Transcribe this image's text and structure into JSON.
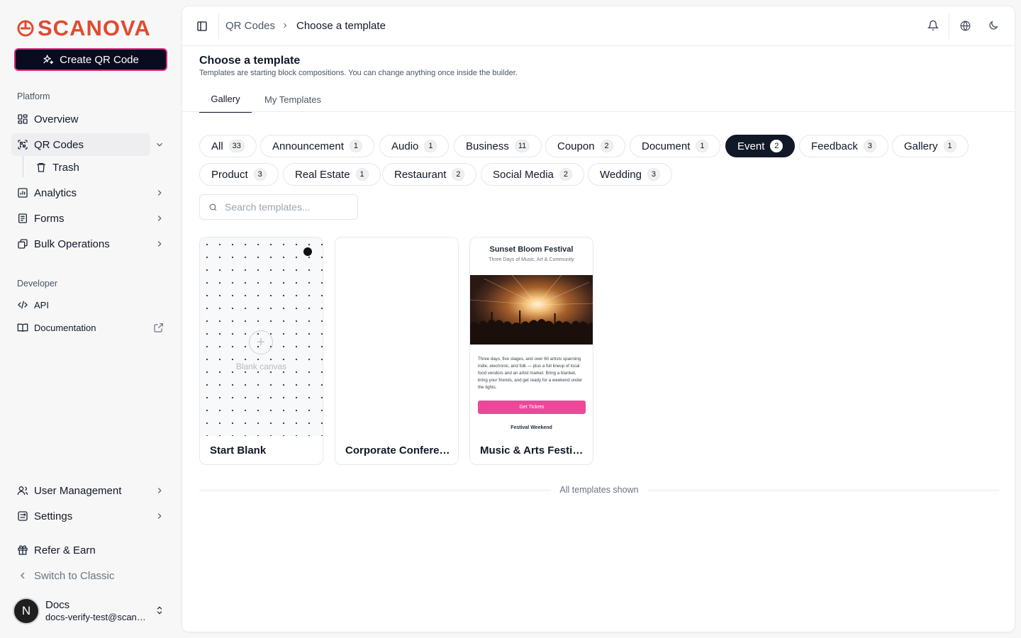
{
  "brand": {
    "name": "SCANOVA",
    "color": "#e14b2f"
  },
  "sidebar": {
    "create_label": "Create QR Code",
    "platform_label": "Platform",
    "items": {
      "overview": "Overview",
      "qr_codes": "QR Codes",
      "trash": "Trash",
      "analytics": "Analytics",
      "forms": "Forms",
      "bulk": "Bulk Operations"
    },
    "developer_label": "Developer",
    "dev_items": {
      "api": "API",
      "docs": "Documentation"
    },
    "bottom_items": {
      "users": "User Management",
      "settings": "Settings",
      "refer": "Refer & Earn",
      "classic": "Switch to Classic"
    },
    "user": {
      "initial": "N",
      "name": "Docs",
      "email": "docs-verify-test@scanova.io"
    }
  },
  "breadcrumb": {
    "parent": "QR Codes",
    "current": "Choose a template"
  },
  "header": {
    "title": "Choose a template",
    "subtitle": "Templates are starting block compositions. You can change anything once inside the builder."
  },
  "tabs": {
    "gallery": "Gallery",
    "mine": "My Templates"
  },
  "categories": [
    {
      "label": "All",
      "count": "33"
    },
    {
      "label": "Announcement",
      "count": "1"
    },
    {
      "label": "Audio",
      "count": "1"
    },
    {
      "label": "Business",
      "count": "11"
    },
    {
      "label": "Coupon",
      "count": "2"
    },
    {
      "label": "Document",
      "count": "1"
    },
    {
      "label": "Event",
      "count": "2",
      "selected": true
    },
    {
      "label": "Feedback",
      "count": "3"
    },
    {
      "label": "Gallery",
      "count": "1"
    },
    {
      "label": "Product",
      "count": "3"
    },
    {
      "label": "Real Estate",
      "count": "1"
    },
    {
      "label": "Restaurant",
      "count": "2"
    },
    {
      "label": "Social Media",
      "count": "2"
    },
    {
      "label": "Wedding",
      "count": "3"
    }
  ],
  "search": {
    "placeholder": "Search templates..."
  },
  "cards": {
    "blank": {
      "name": "Start Blank",
      "canvas_label": "Blank canvas"
    },
    "corporate": {
      "name": "Corporate Conference"
    },
    "festival": {
      "name": "Music & Arts Festival",
      "preview_title": "Sunset Bloom Festival",
      "preview_subtitle": "Three Days of Music, Art & Community",
      "preview_text": "Three days, five stages, and over 60 artists spanning indie, electronic, and folk — plus a full lineup of local food vendors and an artist market. Bring a blanket, bring your friends, and get ready for a weekend under the lights.",
      "preview_button": "Get Tickets",
      "preview_footer": "Festival Weekend",
      "button_color": "#ec4899"
    }
  },
  "footer_note": "All templates shown"
}
